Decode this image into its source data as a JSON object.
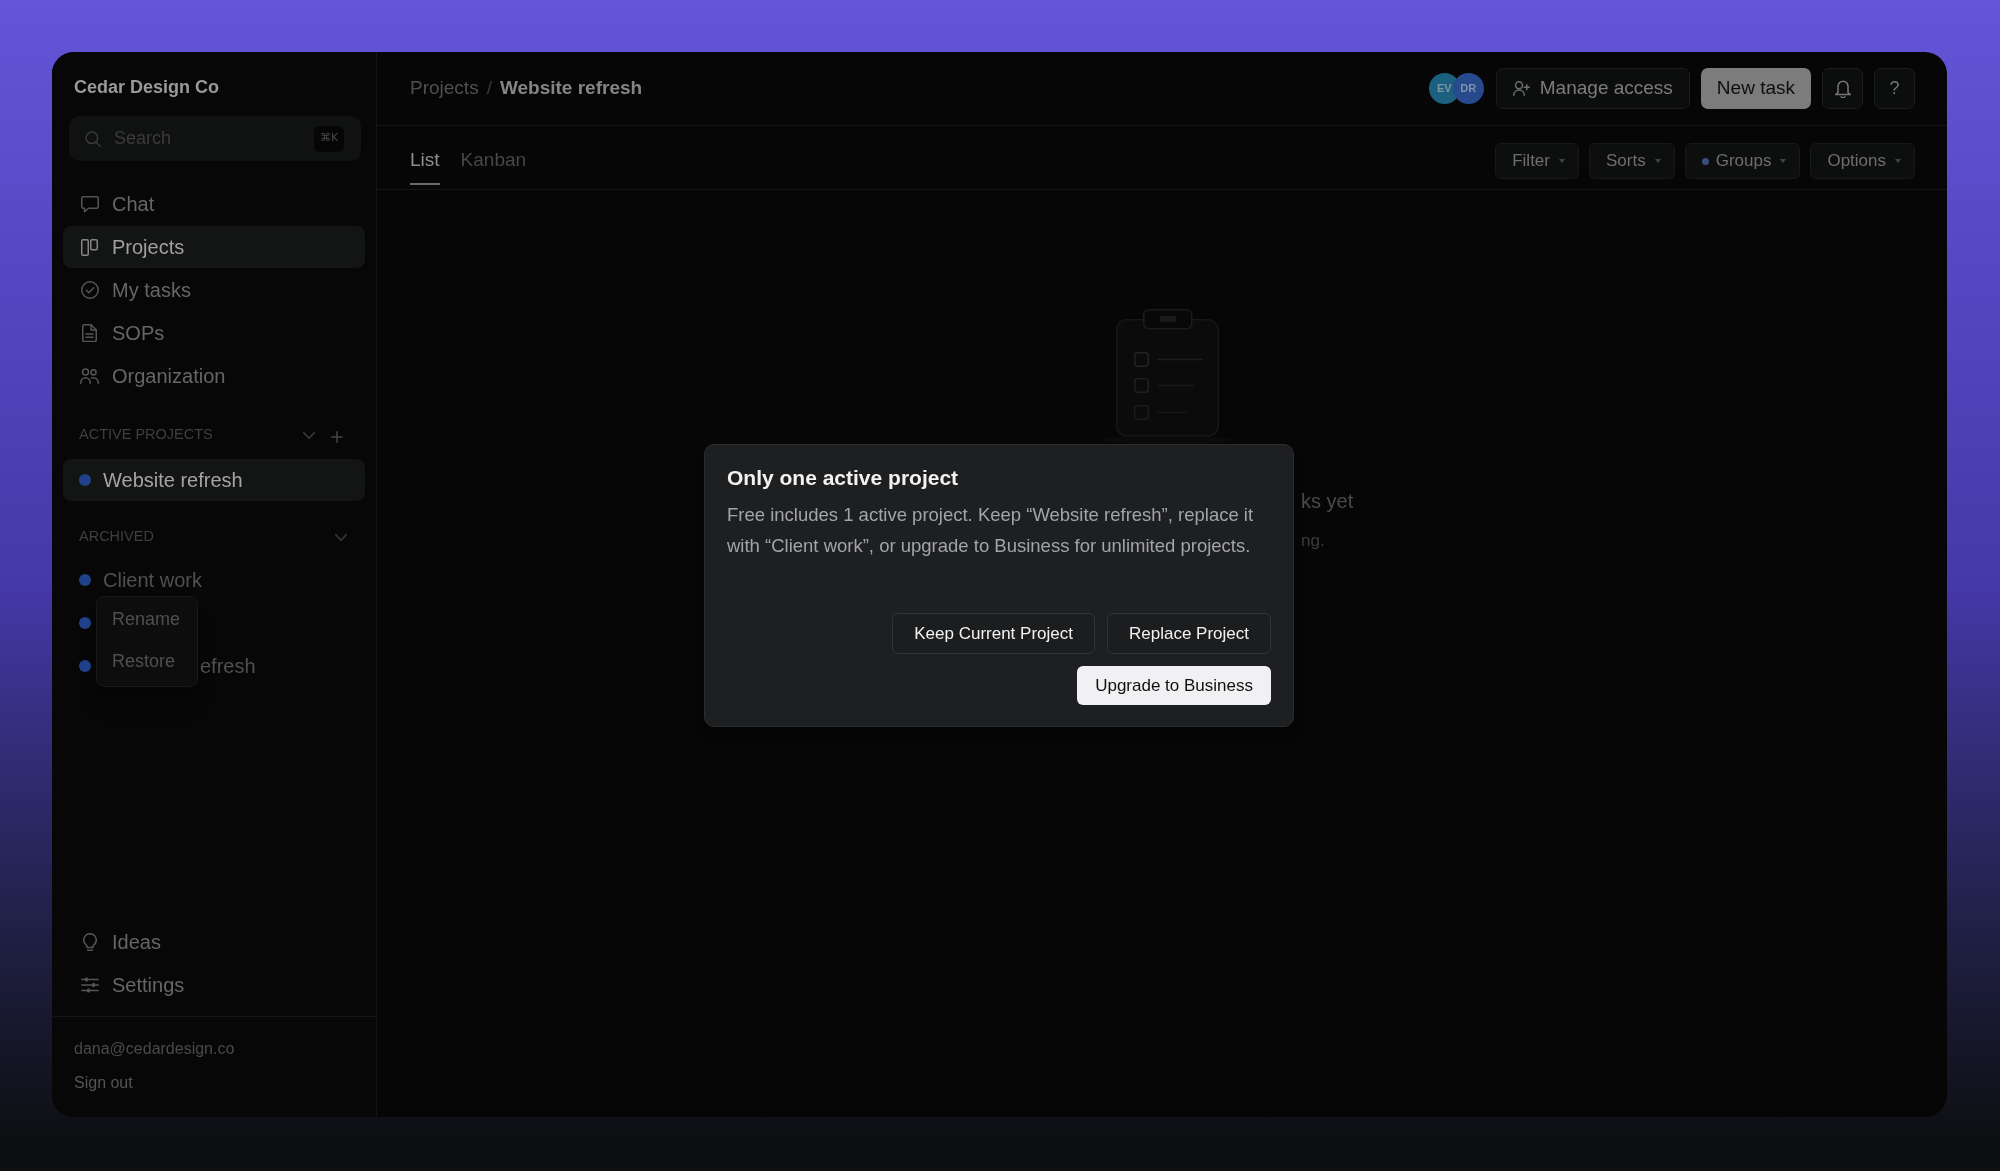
{
  "sidebar": {
    "workspace": "Cedar Design Co",
    "search": {
      "placeholder": "Search",
      "shortcut": "⌘K"
    },
    "nav": [
      {
        "label": "Chat",
        "selected": false
      },
      {
        "label": "Projects",
        "selected": true
      },
      {
        "label": "My tasks",
        "selected": false
      },
      {
        "label": "SOPs",
        "selected": false
      },
      {
        "label": "Organization",
        "selected": false
      }
    ],
    "active_projects": {
      "title": "ACTIVE PROJECTS",
      "items": [
        {
          "label": "Website refresh",
          "selected": true
        }
      ]
    },
    "archived": {
      "title": "ARCHIVED",
      "items": [
        {
          "label": "Client work",
          "selected": false
        },
        {
          "selected": false
        },
        {
          "label": "efresh",
          "selected": false
        }
      ]
    },
    "context_menu": [
      "Rename",
      "Restore"
    ],
    "footer_nav": [
      {
        "label": "Ideas",
        "selected": false
      },
      {
        "label": "Settings",
        "selected": false
      }
    ],
    "account": {
      "email": "dana@cedardesign.co",
      "action": "Sign out"
    }
  },
  "header": {
    "breadcrumb": {
      "items": [
        "Projects",
        "Website refresh"
      ],
      "separator": "/"
    },
    "avatars": [
      {
        "initials": "EV",
        "color": "#1c607f"
      },
      {
        "initials": "DR",
        "color": "#27498e"
      }
    ],
    "actions": [
      {
        "kind": "outline",
        "label": "Manage access"
      },
      {
        "kind": "primary",
        "label": "New task"
      },
      {
        "kind": "bell"
      },
      {
        "kind": "help",
        "label": "?"
      }
    ]
  },
  "tabs": [
    {
      "label": "List",
      "selected": true
    },
    {
      "label": "Kanban",
      "selected": false
    }
  ],
  "view_controls": [
    {
      "label": "Filter",
      "dot": false
    },
    {
      "label": "Sorts",
      "dot": false
    },
    {
      "label": "Groups",
      "dot": true
    },
    {
      "label": "Options",
      "dot": false
    }
  ],
  "empty_state": {
    "title": "ks yet",
    "subtitle": "ng."
  },
  "dialog": {
    "title": "Only one active project",
    "body": "Free includes 1 active project. Keep “Website refresh”, replace it with “Client work”, or upgrade to Business for unlimited projects.",
    "buttons": [
      {
        "kind": "secondary",
        "label": "Keep Current Project"
      },
      {
        "kind": "secondary",
        "label": "Replace Project"
      },
      {
        "kind": "primary",
        "label": "Upgrade to Business"
      }
    ]
  }
}
